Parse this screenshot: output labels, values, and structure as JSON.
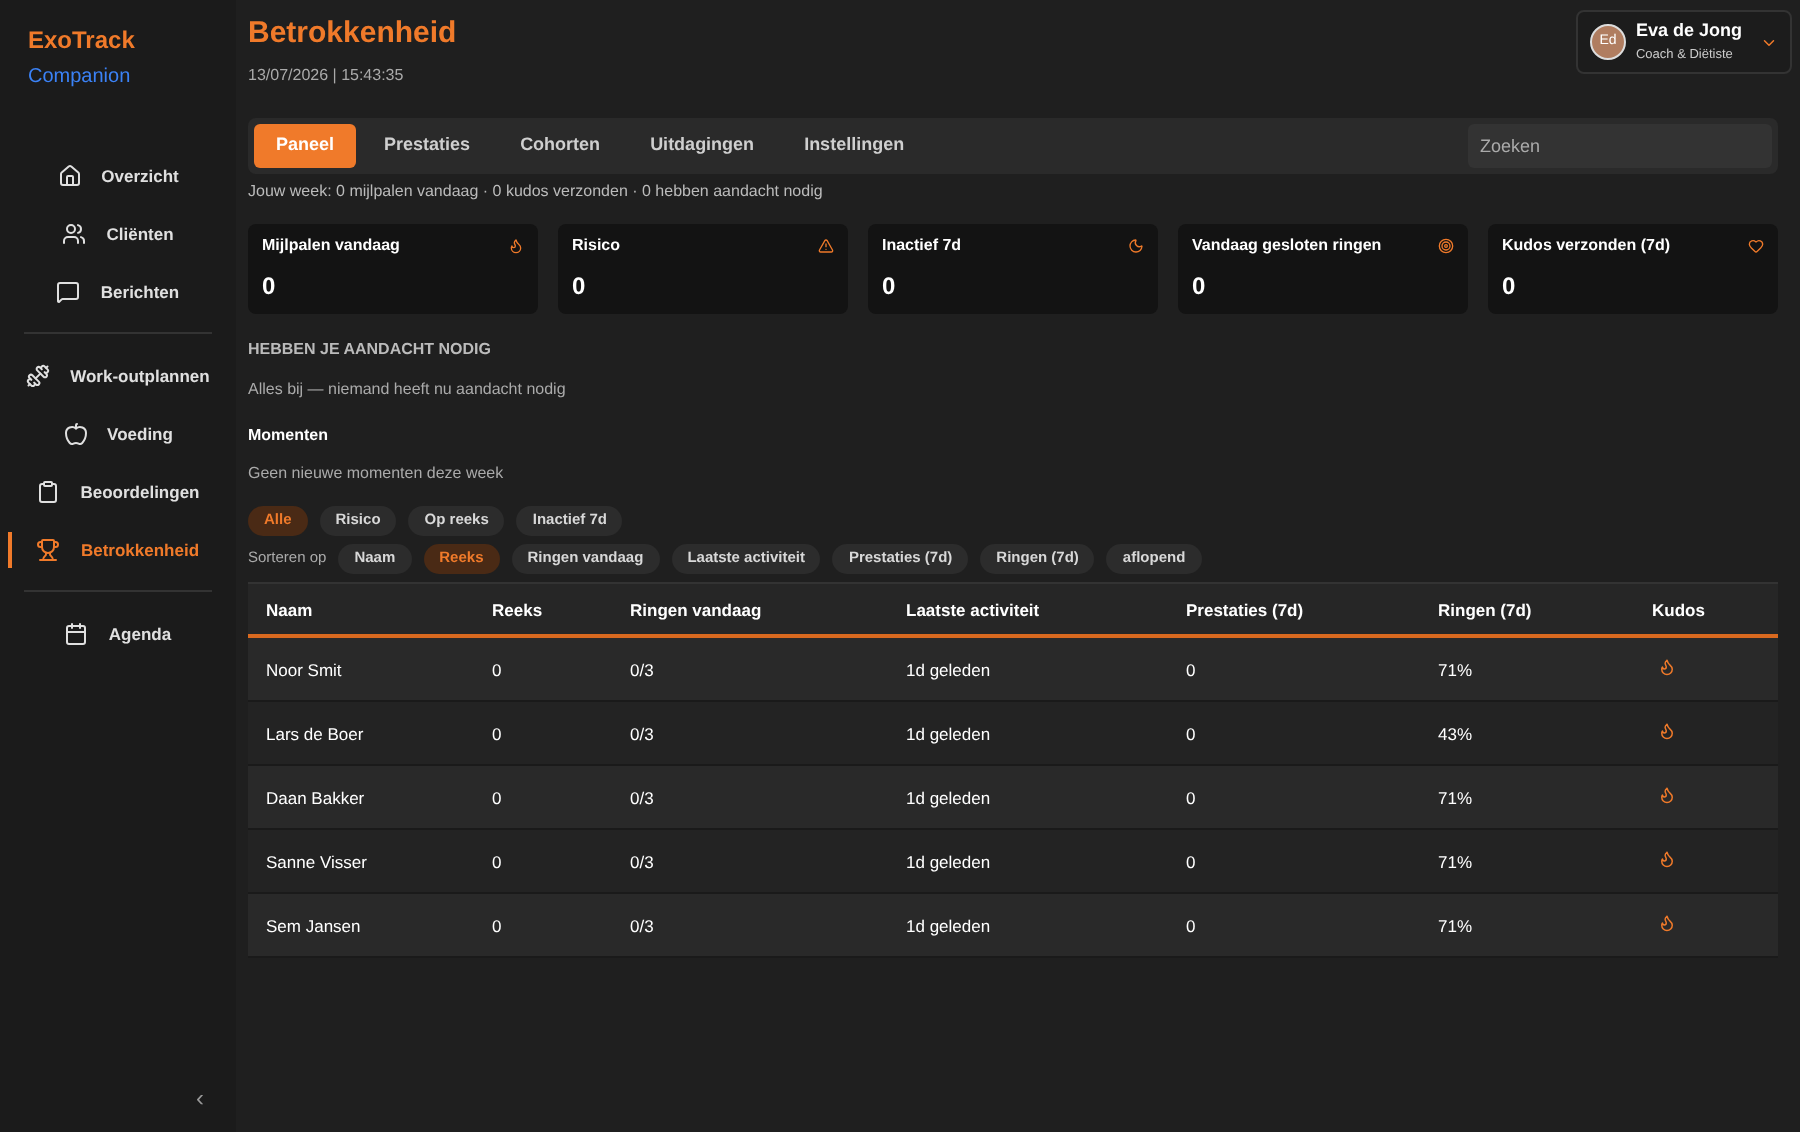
{
  "brand": {
    "name": "ExoTrack",
    "sub": "Companion"
  },
  "sidebar": {
    "groups": [
      [
        {
          "label": "Overzicht",
          "selected": false
        },
        {
          "label": "Cliënten",
          "selected": false
        },
        {
          "label": "Berichten",
          "selected": false
        }
      ],
      [
        {
          "label": "Work-outplannen",
          "selected": false
        },
        {
          "label": "Voeding",
          "selected": false
        },
        {
          "label": "Beoordelingen",
          "selected": false
        },
        {
          "label": "Betrokkenheid",
          "selected": true
        }
      ],
      [
        {
          "label": "Agenda",
          "selected": false
        }
      ]
    ],
    "collapse": "‹"
  },
  "header": {
    "title": "Betrokkenheid",
    "timestamp": "13/07/2026 | 15:43:35"
  },
  "user": {
    "initials": "Ed",
    "name": "Eva de Jong",
    "role": "Coach & Diëtiste"
  },
  "tabs": [
    {
      "label": "Paneel",
      "selected": true
    },
    {
      "label": "Prestaties",
      "selected": false
    },
    {
      "label": "Cohorten",
      "selected": false
    },
    {
      "label": "Uitdagingen",
      "selected": false
    },
    {
      "label": "Instellingen",
      "selected": false
    }
  ],
  "search": {
    "placeholder": "Zoeken"
  },
  "week_summary": "Jouw week: 0 mijlpalen vandaag · 0 kudos verzonden · 0 hebben aandacht nodig",
  "stats": [
    {
      "label": "Mijlpalen vandaag",
      "value": "0"
    },
    {
      "label": "Risico",
      "value": "0"
    },
    {
      "label": "Inactief 7d",
      "value": "0"
    },
    {
      "label": "Vandaag gesloten ringen",
      "value": "0"
    },
    {
      "label": "Kudos verzonden (7d)",
      "value": "0"
    }
  ],
  "attention": {
    "heading": "HEBBEN JE AANDACHT NODIG",
    "text": "Alles bij — niemand heeft nu aandacht nodig"
  },
  "moments": {
    "heading": "Momenten",
    "text": "Geen nieuwe momenten deze week"
  },
  "filters": [
    {
      "label": "Alle",
      "selected": true
    },
    {
      "label": "Risico",
      "selected": false
    },
    {
      "label": "Op reeks",
      "selected": false
    },
    {
      "label": "Inactief 7d",
      "selected": false
    }
  ],
  "sort": {
    "label": "Sorteren op",
    "options": [
      {
        "label": "Naam",
        "selected": false
      },
      {
        "label": "Reeks",
        "selected": true
      },
      {
        "label": "Ringen vandaag",
        "selected": false
      },
      {
        "label": "Laatste activiteit",
        "selected": false
      },
      {
        "label": "Prestaties (7d)",
        "selected": false
      },
      {
        "label": "Ringen (7d)",
        "selected": false
      },
      {
        "label": "aflopend",
        "selected": false
      }
    ]
  },
  "table": {
    "columns": [
      "Naam",
      "Reeks",
      "Ringen vandaag",
      "Laatste activiteit",
      "Prestaties (7d)",
      "Ringen (7d)",
      "Kudos"
    ],
    "rows": [
      [
        "Noor Smit",
        "0",
        "0/3",
        "1d geleden",
        "0",
        "71%"
      ],
      [
        "Lars de Boer",
        "0",
        "0/3",
        "1d geleden",
        "0",
        "43%"
      ],
      [
        "Daan Bakker",
        "0",
        "0/3",
        "1d geleden",
        "0",
        "71%"
      ],
      [
        "Sanne Visser",
        "0",
        "0/3",
        "1d geleden",
        "0",
        "71%"
      ],
      [
        "Sem Jansen",
        "0",
        "0/3",
        "1d geleden",
        "0",
        "71%"
      ]
    ]
  }
}
